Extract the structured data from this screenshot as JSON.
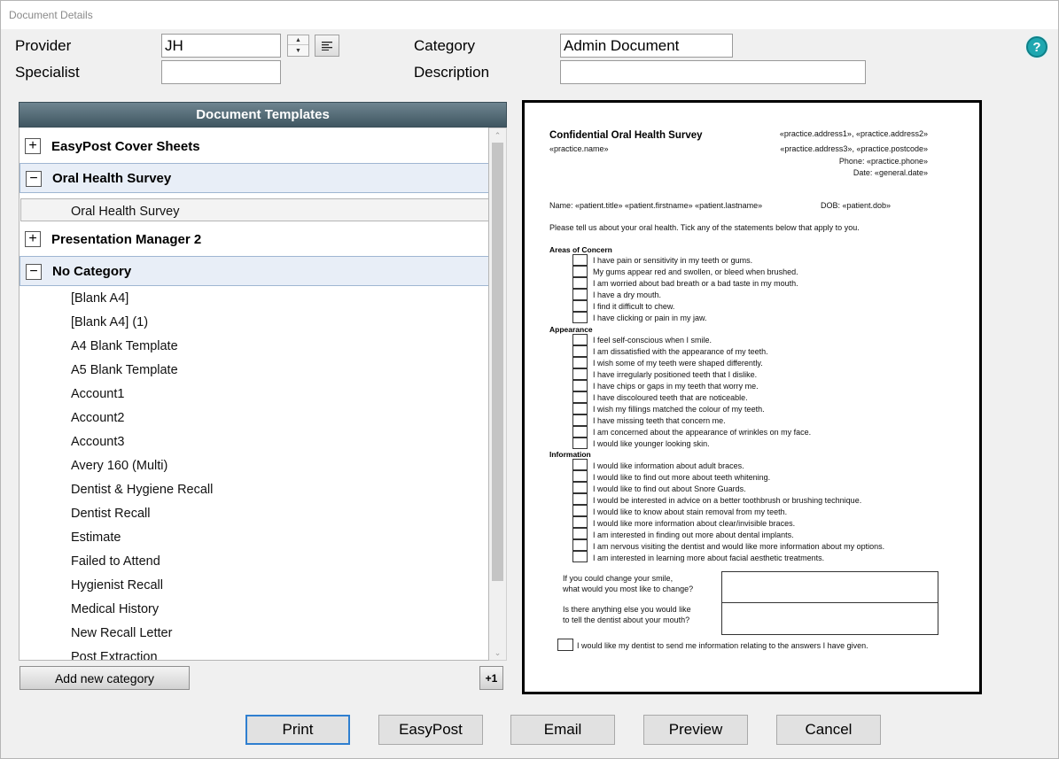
{
  "window": {
    "title": "Document Details"
  },
  "form": {
    "provider_label": "Provider",
    "provider_value": "JH",
    "specialist_label": "Specialist",
    "specialist_value": "",
    "category_label": "Category",
    "category_value": "Admin Document",
    "description_label": "Description",
    "description_value": ""
  },
  "help": {
    "glyph": "?"
  },
  "templates": {
    "header": "Document Templates",
    "categories": [
      {
        "label": "EasyPost Cover Sheets",
        "expanded": false,
        "toggle": "+"
      },
      {
        "label": "Oral Health Survey",
        "expanded": true,
        "toggle": "−",
        "items": [
          "Oral Health Survey"
        ]
      },
      {
        "label": "Presentation Manager 2",
        "expanded": false,
        "toggle": "+"
      },
      {
        "label": "No Category",
        "expanded": true,
        "toggle": "−",
        "items": [
          "[Blank A4]",
          "[Blank A4] (1)",
          "A4 Blank Template",
          "A5 Blank Template",
          "Account1",
          "Account2",
          "Account3",
          "Avery 160 (Multi)",
          "Dentist & Hygiene Recall",
          "Dentist Recall",
          "Estimate",
          "Failed to Attend",
          "Hygienist Recall",
          "Medical History",
          "New Recall Letter",
          "Post Extraction"
        ]
      }
    ],
    "add_category_label": "Add new category",
    "plus_one_label": "+1"
  },
  "preview": {
    "title": "Confidential Oral Health Survey",
    "practice_name": "«practice.name»",
    "address_line1": "«practice.address1», «practice.address2»",
    "address_line2": "«practice.address3», «practice.postcode»",
    "phone_line": "Phone: «practice.phone»",
    "date_line": "Date: «general.date»",
    "name_line": "Name: «patient.title» «patient.firstname» «patient.lastname»",
    "dob_line": "DOB: «patient.dob»",
    "intro": "Please tell us about your oral health. Tick any of the statements below that apply to you.",
    "sections": [
      {
        "title": "Areas of Concern",
        "items": [
          "I have pain or sensitivity in my teeth or gums.",
          "My gums appear red and swollen, or bleed when brushed.",
          "I am worried about bad breath or a bad taste in my mouth.",
          "I have a dry mouth.",
          "I find it difficult to chew.",
          "I have clicking or pain in my jaw."
        ]
      },
      {
        "title": "Appearance",
        "items": [
          "I feel self-conscious when I smile.",
          "I am dissatisfied with the appearance of my teeth.",
          "I wish some of my teeth were shaped differently.",
          "I have irregularly positioned teeth that I dislike.",
          "I have chips or gaps in my teeth that worry me.",
          "I have discoloured teeth that are noticeable.",
          "I wish my fillings matched the colour of my teeth.",
          "I have missing teeth that concern me.",
          "I am concerned about the appearance of wrinkles on my face.",
          "I would like younger looking skin."
        ]
      },
      {
        "title": "Information",
        "items": [
          "I would like information about adult braces.",
          "I would like to find out more about teeth whitening.",
          "I would like to find out about Snore Guards.",
          "I would be interested in advice on a better toothbrush or brushing technique.",
          "I would like to know about stain removal from my teeth.",
          "I would like more information about clear/invisible braces.",
          "I am interested in finding out more about dental implants.",
          "I am nervous visiting the dentist and would like more information about my options.",
          "I am interested in learning more about facial aesthetic treatments."
        ]
      }
    ],
    "q1_line1": "If you could change your smile,",
    "q1_line2": "what would you most like to change?",
    "q2_line1": "Is there anything else you would like",
    "q2_line2": "to tell the dentist about your mouth?",
    "consent": "I would like my dentist to send me information relating to the answers I have given."
  },
  "actions": {
    "print": "Print",
    "easypost": "EasyPost",
    "email": "Email",
    "preview": "Preview",
    "cancel": "Cancel"
  }
}
